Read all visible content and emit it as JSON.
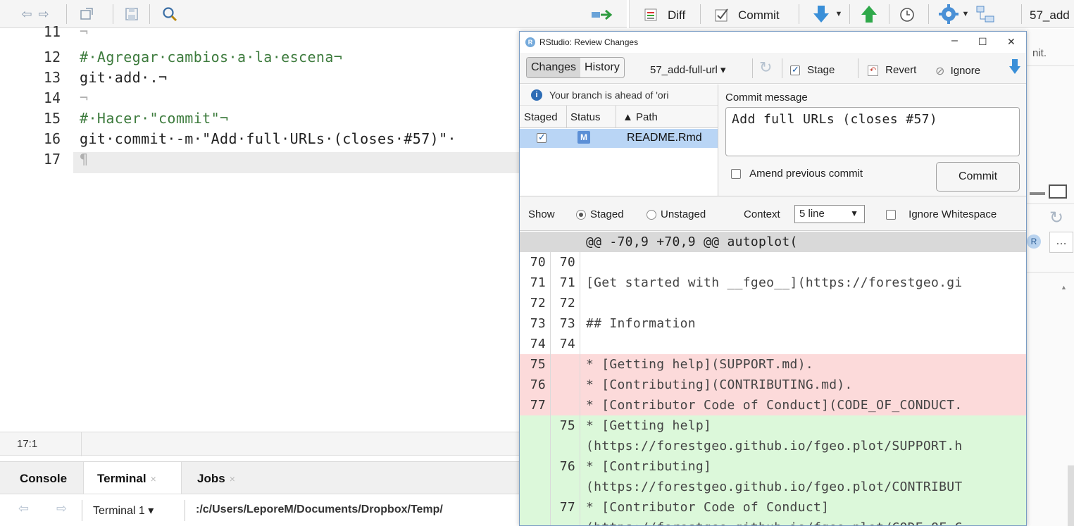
{
  "editor_toolbar": {
    "icons": [
      "back-arrow-icon",
      "forward-arrow-icon",
      "show-in-window-icon",
      "save-icon",
      "search-icon",
      "run-chunk-icon"
    ]
  },
  "git_toolbar": {
    "diff_label": "Diff",
    "commit_label": "Commit",
    "branch_text": "57_add"
  },
  "editor": {
    "lines": [
      {
        "num": "11",
        "text": "¬"
      },
      {
        "num": "12",
        "text": "#·Agregar·cambios·a·la·escena¬"
      },
      {
        "num": "13",
        "text": "git·add·.¬"
      },
      {
        "num": "14",
        "text": "¬"
      },
      {
        "num": "15",
        "text": "#·Hacer·\"commit\"¬"
      },
      {
        "num": "16",
        "text": "git·commit·-m·\"Add·full·URLs·(closes·#57)\"·"
      },
      {
        "num": "17",
        "text": "¶"
      }
    ],
    "cursor_position": "17:1"
  },
  "console": {
    "tabs": [
      {
        "label": "Console"
      },
      {
        "label": "Terminal",
        "close": "×"
      },
      {
        "label": "Jobs",
        "close": "×"
      }
    ],
    "terminal_selector": "Terminal 1 ▾",
    "terminal_path": ":/c/Users/LeporeM/Documents/Dropbox/Temp/"
  },
  "right_pane": {
    "partial_text": "nit."
  },
  "dialog": {
    "title": "RStudio: Review Changes",
    "logo_letter": "R",
    "window_buttons": {
      "minimize": "–",
      "maximize": "☐",
      "close": "✕"
    },
    "toolbar": {
      "changes_label": "Changes",
      "history_label": "History",
      "branch": "57_add-full-url ▾",
      "stage_label": "Stage",
      "revert_label": "Revert",
      "ignore_label": "Ignore"
    },
    "branch_info": "Your branch is ahead of 'ori",
    "files_header": {
      "staged": "Staged",
      "status": "Status",
      "path": "▲ Path"
    },
    "files": [
      {
        "staged": true,
        "status": "M",
        "path": "README.Rmd"
      }
    ],
    "commit": {
      "label": "Commit message",
      "message": "Add full URLs (closes #57)",
      "amend_label": "Amend previous commit",
      "button_label": "Commit"
    },
    "diff_options": {
      "show_label": "Show",
      "staged_label": "Staged",
      "unstaged_label": "Unstaged",
      "context_label": "Context",
      "context_value": "5 line",
      "ignore_ws_label": "Ignore Whitespace"
    },
    "diff": [
      {
        "type": "hunk",
        "old": "",
        "new": "",
        "text": "@@ -70,9 +70,9 @@ autoplot("
      },
      {
        "type": "ctx",
        "old": "70",
        "new": "70",
        "text": ""
      },
      {
        "type": "ctx",
        "old": "71",
        "new": "71",
        "text": "[Get started with __fgeo__](https://forestgeo.gi"
      },
      {
        "type": "ctx",
        "old": "72",
        "new": "72",
        "text": ""
      },
      {
        "type": "ctx",
        "old": "73",
        "new": "73",
        "text": "## Information"
      },
      {
        "type": "ctx",
        "old": "74",
        "new": "74",
        "text": ""
      },
      {
        "type": "del",
        "old": "75",
        "new": "",
        "text": "* [Getting help](SUPPORT.md)."
      },
      {
        "type": "del",
        "old": "76",
        "new": "",
        "text": "* [Contributing](CONTRIBUTING.md)."
      },
      {
        "type": "del",
        "old": "77",
        "new": "",
        "text": "* [Contributor Code of Conduct](CODE_OF_CONDUCT."
      },
      {
        "type": "add",
        "old": "",
        "new": "75",
        "text": "* [Getting help]"
      },
      {
        "type": "add",
        "old": "",
        "new": "",
        "text": "(https://forestgeo.github.io/fgeo.plot/SUPPORT.h"
      },
      {
        "type": "add",
        "old": "",
        "new": "76",
        "text": "* [Contributing]"
      },
      {
        "type": "add",
        "old": "",
        "new": "",
        "text": "(https://forestgeo.github.io/fgeo.plot/CONTRIBUT"
      },
      {
        "type": "add",
        "old": "",
        "new": "77",
        "text": "* [Contributor Code of Conduct]"
      },
      {
        "type": "add",
        "old": "",
        "new": "",
        "text": "(https://forestgeo.github.io/fgeo.plot/CODE_OF_C"
      }
    ]
  }
}
